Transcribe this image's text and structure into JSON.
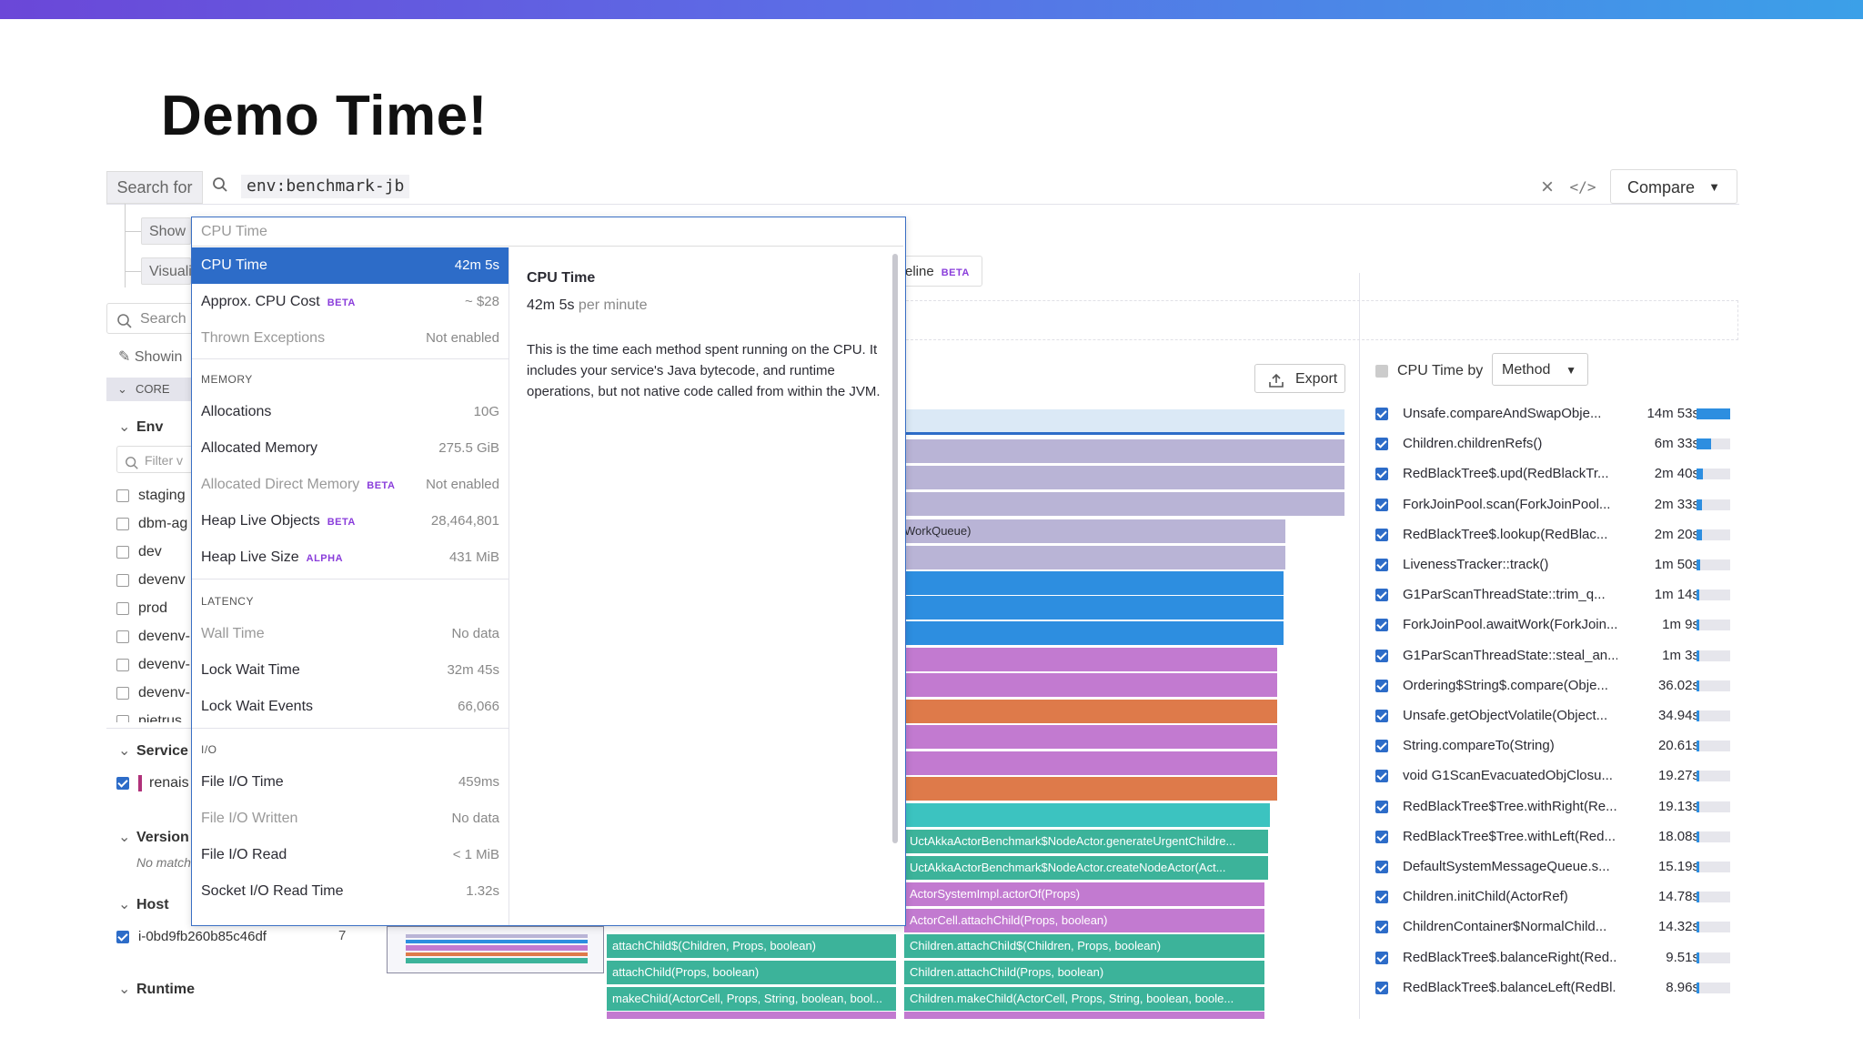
{
  "slide": {
    "title": "Demo Time!"
  },
  "search": {
    "search_for_label": "Search for",
    "query": "env:benchmark-jb",
    "clear_icon": "×",
    "code_icon": "</>",
    "compare_label": "Compare"
  },
  "left_panel": {
    "show_label": "Show",
    "visualize_label": "Visuali",
    "search_placeholder": "Search",
    "showing_label": "Showin",
    "core_label": "CORE",
    "env_heading": "Env",
    "env_filter_placeholder": "Filter v",
    "env_values": [
      "staging",
      "dbm-ag",
      "dev",
      "devenv",
      "prod",
      "devenv-",
      "devenv-",
      "devenv-",
      "pietrus"
    ],
    "service_heading": "Service",
    "service_value": "renais",
    "version_heading": "Version",
    "version_no_match": "No match",
    "host_heading": "Host",
    "host_value": "i-0bd9fb260b85c46df",
    "host_count": "7",
    "runtime_heading": "Runtime"
  },
  "dropdown": {
    "input_placeholder": "CPU Time",
    "items": [
      {
        "label": "CPU Time",
        "value": "42m 5s",
        "badge": "",
        "selected": true,
        "disabled": false
      },
      {
        "label": "Approx. CPU Cost",
        "value": "~ $28",
        "badge": "BETA",
        "selected": false,
        "disabled": false
      },
      {
        "label": "Thrown Exceptions",
        "value": "Not enabled",
        "badge": "",
        "selected": false,
        "disabled": true
      }
    ],
    "memory_section": "MEMORY",
    "memory_items": [
      {
        "label": "Allocations",
        "value": "10G",
        "badge": "",
        "disabled": false
      },
      {
        "label": "Allocated Memory",
        "value": "275.5 GiB",
        "badge": "",
        "disabled": false
      },
      {
        "label": "Allocated Direct Memory",
        "value": "Not enabled",
        "badge": "BETA",
        "disabled": true
      },
      {
        "label": "Heap Live Objects",
        "value": "28,464,801",
        "badge": "BETA",
        "disabled": false
      },
      {
        "label": "Heap Live Size",
        "value": "431 MiB",
        "badge": "ALPHA",
        "disabled": false
      }
    ],
    "latency_section": "LATENCY",
    "latency_items": [
      {
        "label": "Wall Time",
        "value": "No data",
        "disabled": true
      },
      {
        "label": "Lock Wait Time",
        "value": "32m 45s",
        "disabled": false
      },
      {
        "label": "Lock Wait Events",
        "value": "66,066",
        "disabled": false
      }
    ],
    "io_section": "I/O",
    "io_items": [
      {
        "label": "File I/O Time",
        "value": "459ms",
        "disabled": false
      },
      {
        "label": "File I/O Written",
        "value": "No data",
        "disabled": true
      },
      {
        "label": "File I/O Read",
        "value": "< 1 MiB",
        "disabled": false
      },
      {
        "label": "Socket I/O Read Time",
        "value": "1.32s",
        "disabled": false
      }
    ],
    "detail": {
      "title": "CPU Time",
      "rate_value": "42m 5s",
      "rate_unit": "per minute",
      "description": "This is the time each method spent running on the CPU. It includes your service's Java bytecode, and runtime operations, but not native code called from within the JVM."
    }
  },
  "flame": {
    "timeline_label": "eline",
    "timeline_badge": "BETA",
    "export_label": "Export",
    "labels": {
      "workqueue": "WorkQueue)",
      "gen_urgent": "UctAkkaActorBenchmark$NodeActor.generateUrgentChildre...",
      "create_node": "UctAkkaActorBenchmark$NodeActor.createNodeActor(Act...",
      "actor_of": "ActorSystemImpl.actorOf(Props)",
      "attach_child_cell": "ActorCell.attachChild(Props, boolean)",
      "attach_child_left": "attachChild$(Children, Props, boolean)",
      "attach_child_right": "Children.attachChild$(Children, Props, boolean)",
      "attach_left": "attachChild(Props, boolean)",
      "attach_right": "Children.attachChild(Props, boolean)",
      "make_left": "makeChild(ActorCell, Props, String, boolean, bool...",
      "make_right": "Children.makeChild(ActorCell, Props, String, boolean, boole..."
    }
  },
  "right_panel": {
    "header_label": "CPU Time by",
    "group_by": "Method",
    "rows": [
      {
        "name": "Unsafe.compareAndSwapObje...",
        "time": "14m 53s",
        "fraction": 1.0
      },
      {
        "name": "Children.childrenRefs()",
        "time": "6m 33s",
        "fraction": 0.44
      },
      {
        "name": "RedBlackTree$.upd(RedBlackTr...",
        "time": "2m 40s",
        "fraction": 0.18
      },
      {
        "name": "ForkJoinPool.scan(ForkJoinPool...",
        "time": "2m 33s",
        "fraction": 0.17
      },
      {
        "name": "RedBlackTree$.lookup(RedBlac...",
        "time": "2m 20s",
        "fraction": 0.16
      },
      {
        "name": "LivenessTracker::track()",
        "time": "1m 50s",
        "fraction": 0.12
      },
      {
        "name": "G1ParScanThreadState::trim_q...",
        "time": "1m 14s",
        "fraction": 0.08
      },
      {
        "name": "ForkJoinPool.awaitWork(ForkJoin...",
        "time": "1m 9s",
        "fraction": 0.08
      },
      {
        "name": "G1ParScanThreadState::steal_an...",
        "time": "1m 3s",
        "fraction": 0.07
      },
      {
        "name": "Ordering$String$.compare(Obje...",
        "time": "36.02s",
        "fraction": 0.04
      },
      {
        "name": "Unsafe.getObjectVolatile(Object...",
        "time": "34.94s",
        "fraction": 0.04
      },
      {
        "name": "String.compareTo(String)",
        "time": "20.61s",
        "fraction": 0.02
      },
      {
        "name": "void G1ScanEvacuatedObjClosu...",
        "time": "19.27s",
        "fraction": 0.02
      },
      {
        "name": "RedBlackTree$Tree.withRight(Re...",
        "time": "19.13s",
        "fraction": 0.02
      },
      {
        "name": "RedBlackTree$Tree.withLeft(Red...",
        "time": "18.08s",
        "fraction": 0.02
      },
      {
        "name": "DefaultSystemMessageQueue.s...",
        "time": "15.19s",
        "fraction": 0.02
      },
      {
        "name": "Children.initChild(ActorRef)",
        "time": "14.78s",
        "fraction": 0.02
      },
      {
        "name": "ChildrenContainer$NormalChild...",
        "time": "14.32s",
        "fraction": 0.02
      },
      {
        "name": "RedBlackTree$.balanceRight(Red...",
        "time": "9.51s",
        "fraction": 0.01
      },
      {
        "name": "RedBlackTree$.balanceLeft(RedBl...",
        "time": "8.96s",
        "fraction": 0.01
      }
    ]
  },
  "colors": {
    "accent": "#2d6cc8",
    "beta": "#8a3ddb",
    "violet": "#c27ad0",
    "teal": "#3cb39a",
    "blue": "#2d8ee0",
    "orange": "#de7a4a",
    "lavender": "#b9b4d6"
  }
}
